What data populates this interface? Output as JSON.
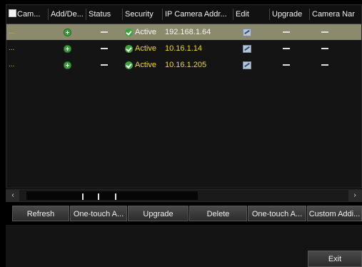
{
  "table": {
    "headers": {
      "camera": "Cam...",
      "add_delete": "Add/De...",
      "status": "Status",
      "security": "Security",
      "ip_address": "IP Camera Addr...",
      "edit": "Edit",
      "upgrade": "Upgrade",
      "camera_name": "Camera Nar"
    },
    "rows": [
      {
        "camera": "...",
        "security": "Active",
        "ip": "192.168.1.64",
        "selected": true
      },
      {
        "camera": "...",
        "security": "Active",
        "ip": "10.16.1.14",
        "selected": false
      },
      {
        "camera": "...",
        "security": "Active",
        "ip": "10.16.1.205",
        "selected": false
      }
    ]
  },
  "scrollbar": {
    "left_arrow": "‹",
    "right_arrow": "›"
  },
  "buttons": {
    "refresh": "Refresh",
    "one_touch_1": "One-touch A...",
    "upgrade": "Upgrade",
    "delete": "Delete",
    "one_touch_2": "One-touch A...",
    "custom_add": "Custom Addi...",
    "exit": "Exit"
  },
  "icons": {
    "add": "plus-circle-icon",
    "security_ok": "check-circle-icon",
    "edit": "edit-icon"
  },
  "colors": {
    "selected_row": "#8c8a6c",
    "ip_text": "#f0dc1e",
    "active_green": "#3aa43a"
  }
}
